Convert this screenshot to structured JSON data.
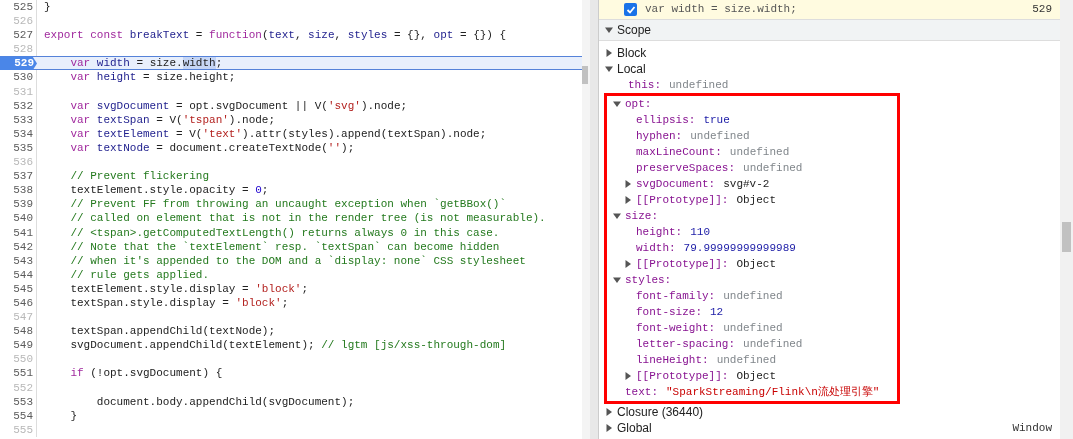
{
  "editor": {
    "lines": [
      {
        "number": "525",
        "current": false,
        "tokens": [
          {
            "kind": "p",
            "text": "}"
          }
        ]
      },
      {
        "number": "526",
        "current": false
      },
      {
        "number": "527",
        "current": false,
        "tokens": [
          {
            "kind": "kw",
            "text": "export const "
          },
          {
            "kind": "def",
            "text": "breakText"
          },
          {
            "kind": "p",
            "text": " = "
          },
          {
            "kind": "kw",
            "text": "function"
          },
          {
            "kind": "p",
            "text": "("
          },
          {
            "kind": "def",
            "text": "text"
          },
          {
            "kind": "p",
            "text": ", "
          },
          {
            "kind": "def",
            "text": "size"
          },
          {
            "kind": "p",
            "text": ", "
          },
          {
            "kind": "def",
            "text": "styles"
          },
          {
            "kind": "p",
            "text": " = {}, "
          },
          {
            "kind": "def",
            "text": "opt"
          },
          {
            "kind": "p",
            "text": " = {}) {"
          }
        ]
      },
      {
        "number": "528",
        "current": false
      },
      {
        "number": "529",
        "current": true,
        "tokens": [
          {
            "kind": "kw",
            "text": "    var "
          },
          {
            "kind": "def",
            "text": "width"
          },
          {
            "kind": "p",
            "text": " = size."
          },
          {
            "kind": "sel",
            "text": "width"
          },
          {
            "kind": "p",
            "text": ";"
          }
        ]
      },
      {
        "number": "530",
        "current": false,
        "tokens": [
          {
            "kind": "kw",
            "text": "    var "
          },
          {
            "kind": "def",
            "text": "height"
          },
          {
            "kind": "p",
            "text": " = size.height;"
          }
        ]
      },
      {
        "number": "531",
        "current": false
      },
      {
        "number": "532",
        "current": false,
        "tokens": [
          {
            "kind": "kw",
            "text": "    var "
          },
          {
            "kind": "def",
            "text": "svgDocument"
          },
          {
            "kind": "p",
            "text": " = opt.svgDocument || V("
          },
          {
            "kind": "str",
            "text": "'svg'"
          },
          {
            "kind": "p",
            "text": ").node;"
          }
        ]
      },
      {
        "number": "533",
        "current": false,
        "tokens": [
          {
            "kind": "kw",
            "text": "    var "
          },
          {
            "kind": "def",
            "text": "textSpan"
          },
          {
            "kind": "p",
            "text": " = V("
          },
          {
            "kind": "str",
            "text": "'tspan'"
          },
          {
            "kind": "p",
            "text": ").node;"
          }
        ]
      },
      {
        "number": "534",
        "current": false,
        "tokens": [
          {
            "kind": "kw",
            "text": "    var "
          },
          {
            "kind": "def",
            "text": "textElement"
          },
          {
            "kind": "p",
            "text": " = V("
          },
          {
            "kind": "str",
            "text": "'text'"
          },
          {
            "kind": "p",
            "text": ").attr(styles).append(textSpan).node;"
          }
        ]
      },
      {
        "number": "535",
        "current": false,
        "tokens": [
          {
            "kind": "kw",
            "text": "    var "
          },
          {
            "kind": "def",
            "text": "textNode"
          },
          {
            "kind": "p",
            "text": " = document.createTextNode("
          },
          {
            "kind": "str",
            "text": "''"
          },
          {
            "kind": "p",
            "text": ");"
          }
        ]
      },
      {
        "number": "536",
        "current": false
      },
      {
        "number": "537",
        "current": false,
        "tokens": [
          {
            "kind": "com",
            "text": "    // Prevent flickering"
          }
        ]
      },
      {
        "number": "538",
        "current": false,
        "tokens": [
          {
            "kind": "p",
            "text": "    textElement.style.opacity = "
          },
          {
            "kind": "num",
            "text": "0"
          },
          {
            "kind": "p",
            "text": ";"
          }
        ]
      },
      {
        "number": "539",
        "current": false,
        "tokens": [
          {
            "kind": "com",
            "text": "    // Prevent FF from throwing an uncaught exception when `getBBox()`"
          }
        ]
      },
      {
        "number": "540",
        "current": false,
        "tokens": [
          {
            "kind": "com",
            "text": "    // called on element that is not in the render tree (is not measurable)."
          }
        ]
      },
      {
        "number": "541",
        "current": false,
        "tokens": [
          {
            "kind": "com",
            "text": "    // <tspan>.getComputedTextLength() returns always 0 in this case."
          }
        ]
      },
      {
        "number": "542",
        "current": false,
        "tokens": [
          {
            "kind": "com",
            "text": "    // Note that the `textElement` resp. `textSpan` can become hidden"
          }
        ]
      },
      {
        "number": "543",
        "current": false,
        "tokens": [
          {
            "kind": "com",
            "text": "    // when it's appended to the DOM and a `display: none` CSS stylesheet"
          }
        ]
      },
      {
        "number": "544",
        "current": false,
        "tokens": [
          {
            "kind": "com",
            "text": "    // rule gets applied."
          }
        ]
      },
      {
        "number": "545",
        "current": false,
        "tokens": [
          {
            "kind": "p",
            "text": "    textElement.style.display = "
          },
          {
            "kind": "str",
            "text": "'block'"
          },
          {
            "kind": "p",
            "text": ";"
          }
        ]
      },
      {
        "number": "546",
        "current": false,
        "tokens": [
          {
            "kind": "p",
            "text": "    textSpan.style.display = "
          },
          {
            "kind": "str",
            "text": "'block'"
          },
          {
            "kind": "p",
            "text": ";"
          }
        ]
      },
      {
        "number": "547",
        "current": false
      },
      {
        "number": "548",
        "current": false,
        "tokens": [
          {
            "kind": "p",
            "text": "    textSpan.appendChild(textNode);"
          }
        ]
      },
      {
        "number": "549",
        "current": false,
        "tokens": [
          {
            "kind": "p",
            "text": "    svgDocument.appendChild(textElement); "
          },
          {
            "kind": "com",
            "text": "// lgtm [js/xss-through-dom]"
          }
        ]
      },
      {
        "number": "550",
        "current": false
      },
      {
        "number": "551",
        "current": false,
        "tokens": [
          {
            "kind": "kw",
            "text": "    if"
          },
          {
            "kind": "p",
            "text": " (!opt.svgDocument) {"
          }
        ]
      },
      {
        "number": "552",
        "current": false
      },
      {
        "number": "553",
        "current": false,
        "tokens": [
          {
            "kind": "p",
            "text": "        document.body.appendChild(svgDocument);"
          }
        ]
      },
      {
        "number": "554",
        "current": false,
        "tokens": [
          {
            "kind": "p",
            "text": "    }"
          }
        ]
      },
      {
        "number": "555",
        "current": false
      }
    ]
  },
  "breakpoint": {
    "checked": true,
    "code": "var width = size.width;",
    "line": "529"
  },
  "scope": {
    "label": "Scope",
    "expanded": true,
    "sections": [
      {
        "name": "Block",
        "expanded": false
      },
      {
        "name": "Local",
        "expanded": true,
        "children": [
          {
            "name": "this:",
            "value": "undefined",
            "kind": "undef",
            "highlighted": false
          },
          {
            "name": "opt:",
            "expanded": true,
            "highlighted": true,
            "children": [
              {
                "name": "ellipsis:",
                "value": "true",
                "kind": "literal"
              },
              {
                "name": "hyphen:",
                "value": "undefined",
                "kind": "undef"
              },
              {
                "name": "maxLineCount:",
                "value": "undefined",
                "kind": "undef"
              },
              {
                "name": "preserveSpaces:",
                "value": "undefined",
                "kind": "undef"
              },
              {
                "name": "svgDocument:",
                "value": "svg#v-2",
                "kind": "node",
                "expanded": false
              },
              {
                "name": "[[Prototype]]:",
                "value": "Object",
                "kind": "object",
                "expanded": false
              }
            ]
          },
          {
            "name": "size:",
            "expanded": true,
            "highlighted": true,
            "children": [
              {
                "name": "height:",
                "value": "110",
                "kind": "literal"
              },
              {
                "name": "width:",
                "value": "79.99999999999989",
                "kind": "literal"
              },
              {
                "name": "[[Prototype]]:",
                "value": "Object",
                "kind": "object",
                "expanded": false
              }
            ]
          },
          {
            "name": "styles:",
            "expanded": true,
            "highlighted": true,
            "children": [
              {
                "name": "font-family:",
                "value": "undefined",
                "kind": "undef"
              },
              {
                "name": "font-size:",
                "value": "12",
                "kind": "literal"
              },
              {
                "name": "font-weight:",
                "value": "undefined",
                "kind": "undef"
              },
              {
                "name": "letter-spacing:",
                "value": "undefined",
                "kind": "undef"
              },
              {
                "name": "lineHeight:",
                "value": "undefined",
                "kind": "undef"
              },
              {
                "name": "[[Prototype]]:",
                "value": "Object",
                "kind": "object",
                "expanded": false
              }
            ]
          },
          {
            "name": "text:",
            "value": "\"SparkStreaming/Flink\\n流处理引擎\"",
            "kind": "string",
            "highlighted": true
          }
        ]
      },
      {
        "name": "Closure (36440)",
        "expanded": false
      },
      {
        "name": "Global",
        "expanded": false,
        "value": "Window"
      }
    ]
  }
}
